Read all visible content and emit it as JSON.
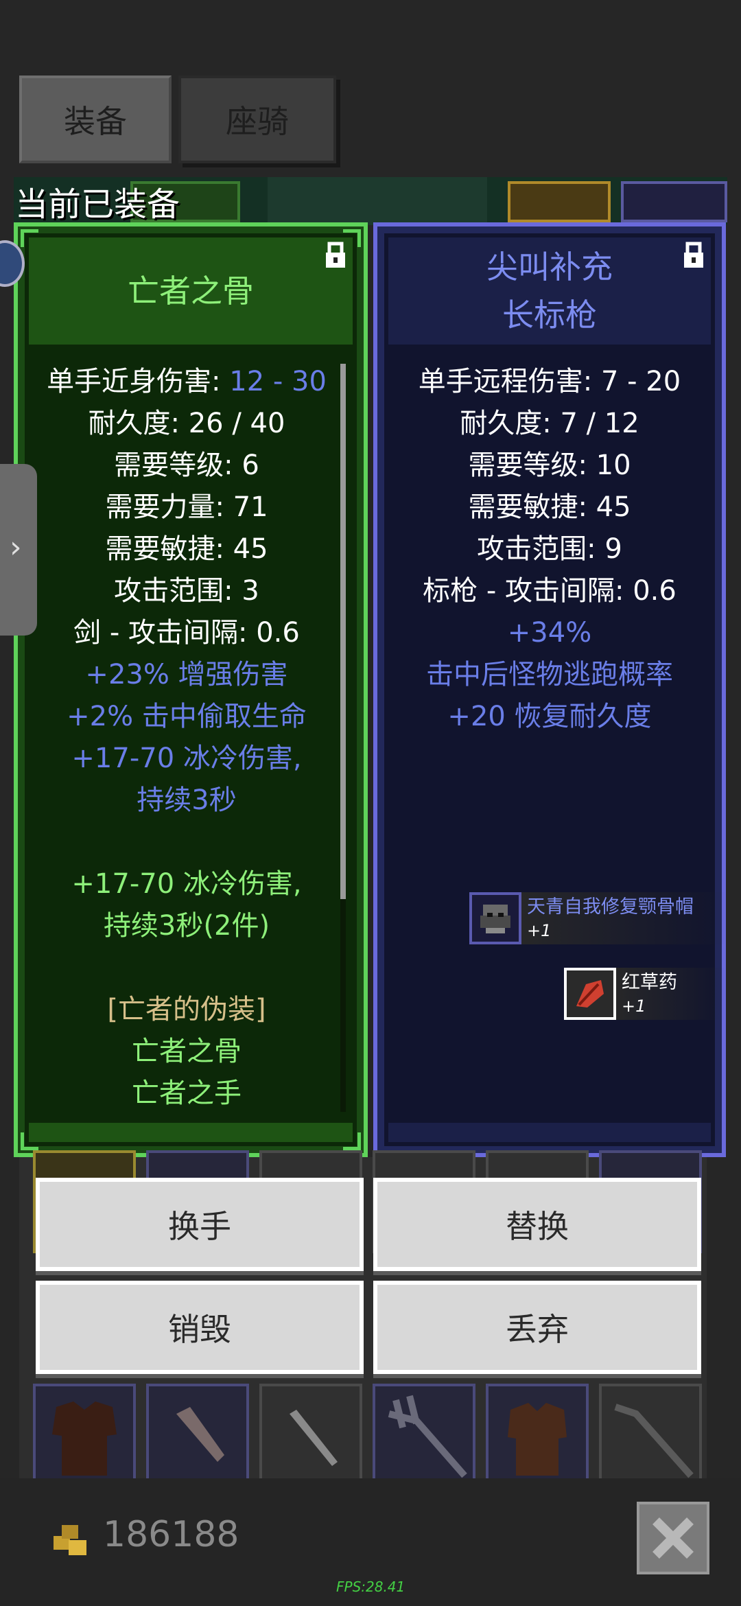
{
  "tabs": [
    {
      "label": "装备",
      "active": true
    },
    {
      "label": "座骑",
      "active": false
    }
  ],
  "equipped_label": "当前已装备",
  "left_item": {
    "name": "亡者之骨",
    "rarity_color": "#8ef07a",
    "stats": [
      {
        "text": "单手近身伤害: ",
        "value": "12 - 30",
        "style": "white"
      },
      {
        "text": "耐久度: 26 / 40",
        "style": "white"
      },
      {
        "text": "需要等级: 6",
        "style": "white"
      },
      {
        "text": "需要力量: 71",
        "style": "white"
      },
      {
        "text": "需要敏捷: 45",
        "style": "white"
      },
      {
        "text": "攻击范围: 3",
        "style": "white"
      },
      {
        "text": "剑 - 攻击间隔: 0.6",
        "style": "white"
      },
      {
        "text": "+23% 增强伤害",
        "style": "blue"
      },
      {
        "text": "+2% 击中偷取生命",
        "style": "blue"
      },
      {
        "text": "+17-70 冰冷伤害,",
        "style": "blue"
      },
      {
        "text": "持续3秒",
        "style": "blue"
      },
      {
        "text": "",
        "style": "gap"
      },
      {
        "text": "+17-70 冰冷伤害,",
        "style": "green"
      },
      {
        "text": "持续3秒(2件)",
        "style": "green"
      },
      {
        "text": "",
        "style": "gap"
      },
      {
        "text": "[亡者的伪装]",
        "style": "gold"
      },
      {
        "text": "亡者之骨",
        "style": "green"
      },
      {
        "text": "亡者之手",
        "style": "green"
      }
    ]
  },
  "right_item": {
    "name_line1": "尖叫补充",
    "name_line2": "长标枪",
    "rarity_color": "#7c8cf0",
    "stats": [
      {
        "text": "单手远程伤害: 7 - 20",
        "style": "white"
      },
      {
        "text": "耐久度: 7 / 12",
        "style": "white"
      },
      {
        "text": "需要等级: 10",
        "style": "white"
      },
      {
        "text": "需要敏捷: 45",
        "style": "white"
      },
      {
        "text": "攻击范围: 9",
        "style": "white"
      },
      {
        "text": "标枪 - 攻击间隔: 0.6",
        "style": "white"
      },
      {
        "text": "+34%",
        "style": "blue"
      },
      {
        "text": "击中后怪物逃跑概率",
        "style": "blue"
      },
      {
        "text": "+20 恢复耐久度",
        "style": "blue"
      }
    ]
  },
  "drops": [
    {
      "name": "天青自我修复颚骨帽",
      "count": "+1",
      "name_color": "#7c8cf0",
      "icon": "helmet-icon"
    },
    {
      "name": "红草药",
      "count": "+1",
      "name_color": "#ffffff",
      "icon": "red-herb-icon"
    }
  ],
  "actions": {
    "swap_hand": "换手",
    "replace": "替换",
    "destroy": "销毁",
    "discard": "丢弃"
  },
  "gold": "186188",
  "fps": "FPS:28.41",
  "colors": {
    "unique_border": "#5fd35a",
    "magic_border": "#6a6adc",
    "magic_text": "#6a7ee8"
  }
}
